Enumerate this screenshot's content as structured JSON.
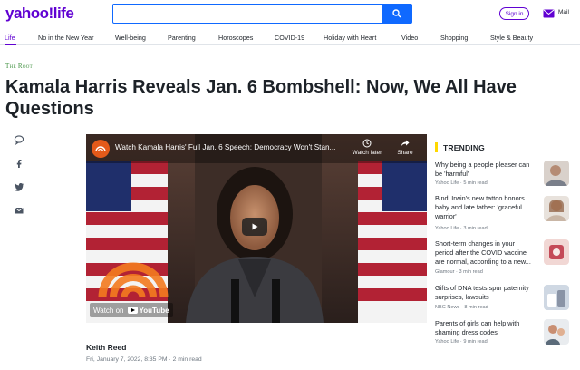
{
  "header": {
    "logo": "yahoo!life",
    "search_placeholder": "",
    "signin_label": "Sign in",
    "mail_label": "Mail",
    "accent": "#6001d2",
    "search_button_color": "#0f69ff"
  },
  "nav": {
    "items": [
      "Life",
      "No in the New Year",
      "Well-being",
      "Parenting",
      "Horoscopes",
      "COVID-19",
      "Holiday with Heart",
      "Video",
      "Shopping",
      "Style & Beauty"
    ],
    "active": "Life"
  },
  "article": {
    "source": "The Root",
    "headline": "Kamala Harris Reveals Jan. 6 Bombshell: Now, We All Have Questions",
    "author": "Keith Reed",
    "date": "Fri, January 7, 2022, 8:35 PM",
    "read_time": "2 min read",
    "share_icons": [
      "comment-icon",
      "facebook-icon",
      "twitter-icon",
      "email-icon"
    ]
  },
  "video": {
    "title": "Watch Kamala Harris' Full Jan. 6 Speech: Democracy Won't Stan...",
    "watch_later": "Watch later",
    "share": "Share",
    "watch_on": "Watch on",
    "youtube": "YouTube"
  },
  "trending": {
    "heading": "TRENDING",
    "items": [
      {
        "title": "Why being a people pleaser can be 'harmful'",
        "source": "Yahoo Life",
        "read": "5 min read"
      },
      {
        "title": "Bindi Irwin's new tattoo honors baby and late father: 'graceful warrior'",
        "source": "Yahoo Life",
        "read": "3 min read"
      },
      {
        "title": "Short-term changes in your period after the COVID vaccine are normal, according to a new...",
        "source": "Glamour",
        "read": "3 min read"
      },
      {
        "title": "Gifts of DNA tests spur paternity surprises, lawsuits",
        "source": "NBC News",
        "read": "8 min read"
      },
      {
        "title": "Parents of girls can help with shaming dress codes",
        "source": "Yahoo Life",
        "read": "9 min read"
      }
    ]
  }
}
